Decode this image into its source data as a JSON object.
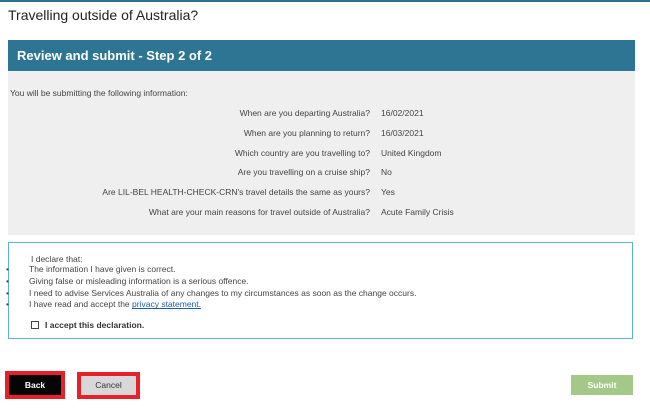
{
  "page": {
    "title": "Travelling outside of Australia?"
  },
  "review": {
    "header": "Review and submit - Step 2 of 2",
    "intro": "You will be submitting the following information:",
    "rows": [
      {
        "question": "When are you departing Australia?",
        "answer": "16/02/2021"
      },
      {
        "question": "When are you planning to return?",
        "answer": "16/03/2021"
      },
      {
        "question": "Which country are you travelling to?",
        "answer": "United Kingdom"
      },
      {
        "question": "Are you travelling on a cruise ship?",
        "answer": "No"
      },
      {
        "question": "Are LIL-BEL HEALTH-CHECK-CRN's travel details the same as yours?",
        "answer": "Yes"
      },
      {
        "question": "What are your main reasons for travel outside of Australia?",
        "answer": "Acute Family Crisis"
      }
    ]
  },
  "declaration": {
    "heading": "I declare that:",
    "bullet": "•",
    "items": [
      "The information I have given is correct.",
      "Giving false or misleading information is a serious offence.",
      "I need to advise Services Australia of any changes to my circumstances as soon as the change occurs."
    ],
    "privacy_prefix": "I have read and accept the ",
    "privacy_link": "privacy statement.",
    "accept_label": "I accept this declaration.",
    "accept_checked": false
  },
  "buttons": {
    "back": "Back",
    "cancel": "Cancel",
    "submit": "Submit"
  },
  "colors": {
    "header": "#2d7593",
    "highlight": "#e8202a",
    "submit_disabled": "#a3c887",
    "link": "#1f5fa8"
  }
}
